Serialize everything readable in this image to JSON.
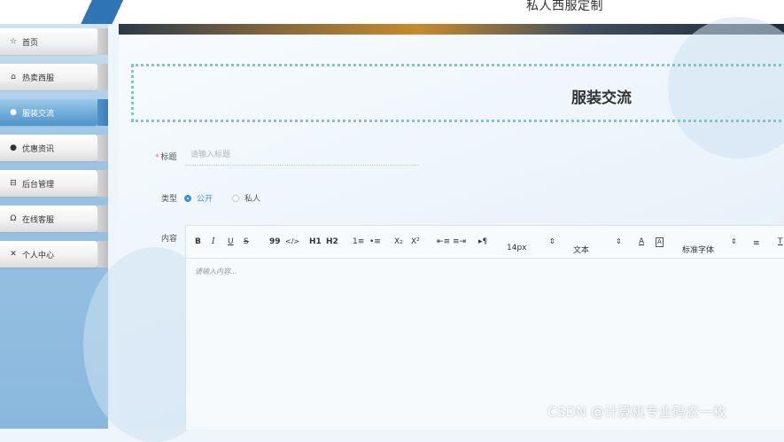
{
  "header": {
    "site_title": "私人西服定制"
  },
  "sidebar": {
    "items": [
      {
        "label": "首页",
        "icon": "star-icon",
        "glyph": "☆"
      },
      {
        "label": "热卖西服",
        "icon": "bag-icon",
        "glyph": "⌂"
      },
      {
        "label": "服装交流",
        "icon": "info-circle-icon",
        "glyph": "●",
        "active": true
      },
      {
        "label": "优惠资讯",
        "icon": "question-circle-icon",
        "glyph": "●"
      },
      {
        "label": "后台管理",
        "icon": "inbox-icon",
        "glyph": "⊟"
      },
      {
        "label": "在线客服",
        "icon": "headset-icon",
        "glyph": "Ω"
      },
      {
        "label": "个人中心",
        "icon": "person-icon",
        "glyph": "✕"
      }
    ]
  },
  "form": {
    "page_title": "服装交流",
    "title_label": "标题",
    "title_required_mark": "*",
    "title_placeholder": "请输入标题",
    "type_label": "类型",
    "type_options": [
      "公开",
      "私人"
    ],
    "type_selected": "公开",
    "content_label": "内容",
    "editor_placeholder": "请输入内容..."
  },
  "toolbar": {
    "bold": "B",
    "italic": "I",
    "underline": "U",
    "strike": "S",
    "blockquote": "99",
    "code": "</>",
    "h1": "H1",
    "h2": "H2",
    "ordered_list": "1≡",
    "bullet_list": "•≡",
    "subscript": "X₂",
    "superscript": "X²",
    "outdent": "⇤≡",
    "indent": "≡⇥",
    "direction": "▸¶",
    "font_size": "14px",
    "font_size_caret": "⇕",
    "text_type": "文本",
    "text_type_caret": "⇕",
    "font_color": "A",
    "bg_color": "A",
    "font_family": "标准字体",
    "font_family_caret": "⇕",
    "align": "≡",
    "clear_format": "T"
  },
  "watermark": "CSDN @计算机专业码农一枚"
}
